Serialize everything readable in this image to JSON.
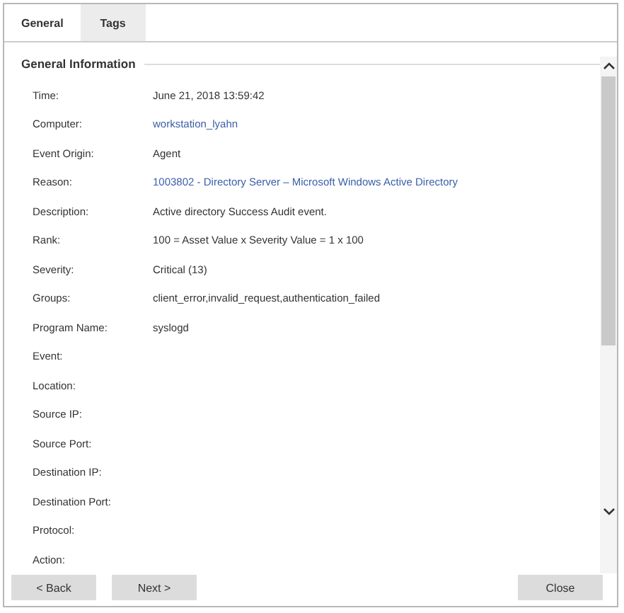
{
  "tabs": [
    {
      "label": "General",
      "selected": true
    },
    {
      "label": "Tags",
      "selected": false
    }
  ],
  "section": {
    "title": "General Information"
  },
  "fields": [
    {
      "label": "Time:",
      "value": "June 21, 2018 13:59:42",
      "kind": "text"
    },
    {
      "label": "Computer:",
      "value": "workstation_lyahn",
      "kind": "link"
    },
    {
      "label": "Event Origin:",
      "value": "Agent",
      "kind": "text"
    },
    {
      "label": "Reason:",
      "value": "1003802 - Directory Server – Microsoft Windows Active Directory",
      "kind": "link"
    },
    {
      "label": "Description:",
      "value": "Active directory Success Audit event.",
      "kind": "text"
    },
    {
      "label": "Rank:",
      "value": "100 = Asset Value x Severity Value = 1 x 100",
      "kind": "text"
    },
    {
      "label": "Severity:",
      "value": "Critical (13)",
      "kind": "text"
    },
    {
      "label": "Groups:",
      "value": "client_error,invalid_request,authentication_failed",
      "kind": "text"
    },
    {
      "label": "Program Name:",
      "value": "syslogd",
      "kind": "text"
    },
    {
      "label": "Event:"
    },
    {
      "label": "Location:"
    },
    {
      "label": "Source IP:"
    },
    {
      "label": "Source Port:"
    },
    {
      "label": "Destination IP:"
    },
    {
      "label": "Destination Port:"
    },
    {
      "label": "Protocol:"
    },
    {
      "label": "Action:"
    }
  ],
  "nav_buttons": [
    "< Back",
    "Next >"
  ],
  "close_button": "Close"
}
